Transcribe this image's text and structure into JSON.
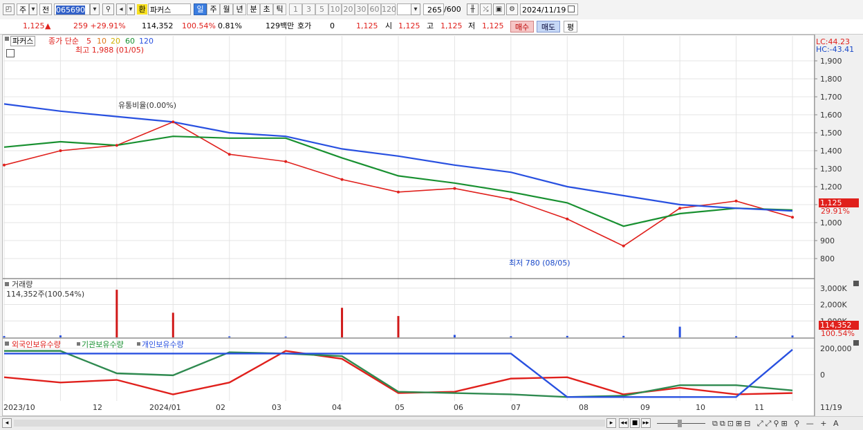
{
  "toolbar": {
    "market_label": "주",
    "prev_label": "전",
    "code_value": "065690",
    "badge": "환",
    "name_value": "파커스",
    "periods": [
      "일",
      "주",
      "월",
      "년",
      "분",
      "초",
      "틱"
    ],
    "minute_intervals": [
      "1",
      "3",
      "5",
      "10",
      "20",
      "30",
      "60",
      "120"
    ],
    "count_value": "265",
    "count_total": "/600",
    "date_value": "2024/11/19"
  },
  "infobar": {
    "price": "1,125",
    "price_arrow": "▲",
    "change": "259 +29.91%",
    "volume": "114,352",
    "volume_ratio": "100.54%",
    "turnover": "0.81%",
    "amount": "129백만",
    "hoga_label": "호가",
    "hoga_value": "0",
    "quote": "1,125",
    "open_label": "시",
    "open": "1,125",
    "high_label": "고",
    "high": "1,125",
    "low_label": "저",
    "low": "1,125",
    "buy_label": "매수",
    "sell_label": "매도",
    "avg_label": "평"
  },
  "price_pane": {
    "name_chip": "파커스",
    "legend_prefix": "종가 단순",
    "ma_periods": [
      "5",
      "10",
      "20",
      "60",
      "120"
    ],
    "ma_colors": [
      "#e0201c",
      "#e07818",
      "#f0d000",
      "#189030",
      "#2850e0"
    ],
    "high_annotation": "최고 1,988 (01/05)",
    "low_annotation": "최저 780 (08/05)",
    "overlay_label": "유통비율(0.00%)",
    "lc": "LC:44.23",
    "hc": "HC:-43.41",
    "current_price_tag": "1,125",
    "current_change_tag": "29.91%"
  },
  "volume_pane": {
    "title": "거래량",
    "value_text": "114,352주(100.54%)",
    "current_tag": "114,352",
    "current_ratio_tag": "100.54%"
  },
  "holding_pane": {
    "titles": [
      "외국인보유수량",
      "기관보유수량",
      "개인보유수량"
    ],
    "title_colors": [
      "#e0201c",
      "#189030",
      "#2850e0"
    ]
  },
  "x_axis": [
    "2023/10",
    "12",
    "2024/01",
    "02",
    "03",
    "04",
    "05",
    "06",
    "07",
    "08",
    "09",
    "10",
    "11",
    "11/19"
  ],
  "chart_data": [
    {
      "type": "line",
      "title": "",
      "y_axis_ticks": [
        800,
        900,
        1000,
        1100,
        1200,
        1300,
        1400,
        1500,
        1600,
        1700,
        1800,
        1900
      ],
      "ylim": [
        700,
        2000
      ],
      "x": [
        "2023/10",
        "11",
        "12",
        "2024/01",
        "02",
        "03",
        "04",
        "05",
        "06",
        "07",
        "08",
        "09",
        "10",
        "11",
        "11/19"
      ],
      "series": [
        {
          "name": "5",
          "values": [
            1320,
            1400,
            1430,
            1560,
            1380,
            1340,
            1240,
            1170,
            1190,
            1130,
            1020,
            870,
            1080,
            1120,
            1030
          ]
        },
        {
          "name": "60",
          "values": [
            1420,
            1450,
            1430,
            1480,
            1470,
            1470,
            1360,
            1260,
            1220,
            1170,
            1110,
            980,
            1050,
            1080,
            1070
          ]
        },
        {
          "name": "120",
          "values": [
            1660,
            1620,
            1590,
            1560,
            1500,
            1480,
            1410,
            1370,
            1320,
            1280,
            1200,
            1150,
            1100,
            1080,
            1065
          ]
        }
      ],
      "grid": true
    },
    {
      "type": "bar",
      "title": "거래량",
      "y_axis_ticks": [
        "1,000K",
        "2,000K",
        "3,000K"
      ],
      "ylim": [
        0,
        3200
      ],
      "x": [
        "2023/10",
        "11",
        "12",
        "2024/01",
        "02",
        "03",
        "04",
        "05",
        "06",
        "07",
        "08",
        "09",
        "10",
        "11",
        "11/19"
      ],
      "values": [
        80,
        120,
        2900,
        1500,
        60,
        50,
        1800,
        1300,
        150,
        70,
        90,
        90,
        650,
        70,
        114
      ]
    },
    {
      "type": "line",
      "y_axis_ticks": [
        "0",
        "200,000"
      ],
      "x": [
        "2023/10",
        "11",
        "12",
        "2024/01",
        "02",
        "03",
        "04",
        "05",
        "06",
        "07",
        "08",
        "09",
        "10",
        "11",
        "11/19"
      ],
      "series": [
        {
          "name": "외국인보유수량",
          "values": [
            -20,
            -60,
            -40,
            -150,
            -60,
            180,
            120,
            -140,
            -130,
            -30,
            -20,
            -150,
            -100,
            -150,
            -140
          ]
        },
        {
          "name": "기관보유수량",
          "values": [
            180,
            180,
            10,
            -5,
            170,
            160,
            140,
            -130,
            -140,
            -150,
            -170,
            -160,
            -80,
            -80,
            -120
          ]
        },
        {
          "name": "개인보유수량",
          "values": [
            160,
            160,
            160,
            160,
            160,
            160,
            160,
            160,
            160,
            160,
            -170,
            -170,
            -170,
            -170,
            190
          ]
        }
      ]
    }
  ]
}
